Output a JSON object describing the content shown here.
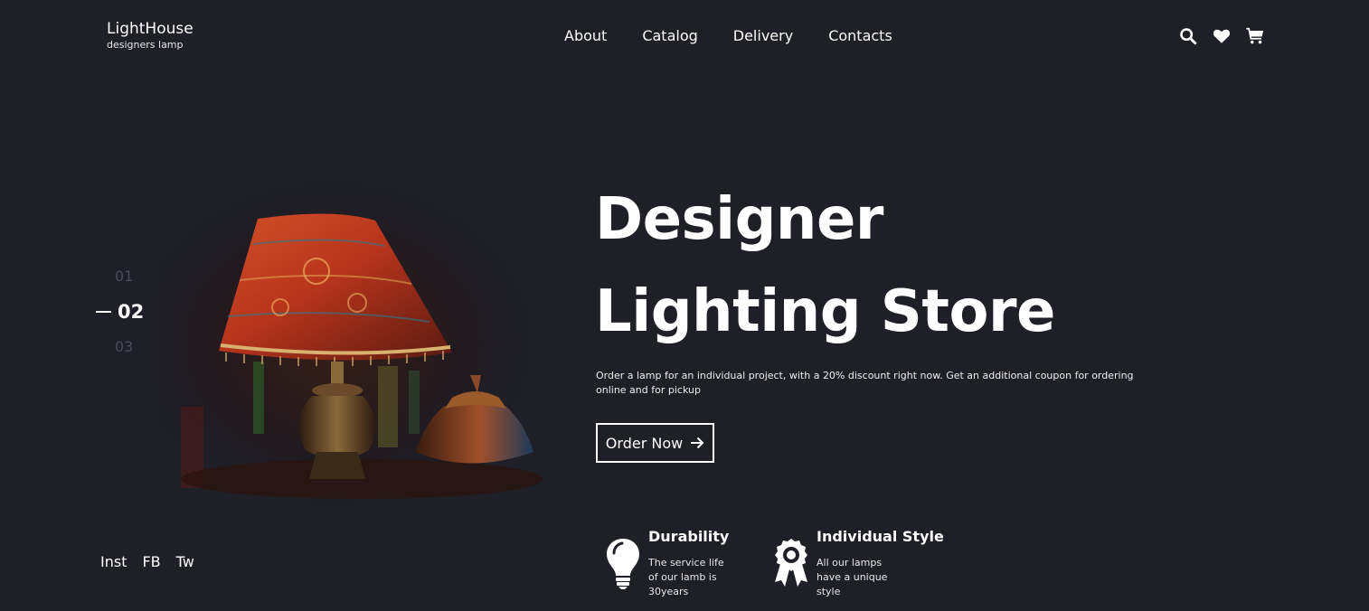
{
  "brand": {
    "title": "LightHouse",
    "subtitle": "designers lamp"
  },
  "nav": {
    "items": [
      "About",
      "Catalog",
      "Delivery",
      "Contacts"
    ]
  },
  "header_icons": [
    "search-icon",
    "heart-icon",
    "cart-icon"
  ],
  "slider": {
    "slides": [
      "01",
      "02",
      "03"
    ],
    "active": "02"
  },
  "hero": {
    "title_line1": "Designer",
    "title_line2": "Lighting Store",
    "description": "Order a lamp for an individual project, with a 20% discount right now. Get an additional coupon for ordering online and for pickup",
    "button_label": "Order Now"
  },
  "features": [
    {
      "icon": "lightbulb-icon",
      "title": "Durability",
      "text": "The service life of our lamb is 30years"
    },
    {
      "icon": "award-badge-icon",
      "title": "Individual Style",
      "text": "All our lamps have a unique style"
    }
  ],
  "social": [
    "Inst",
    "FB",
    "Tw"
  ],
  "colors": {
    "background": "#1e1f27",
    "text": "#ffffff",
    "muted": "#4a4c57"
  }
}
